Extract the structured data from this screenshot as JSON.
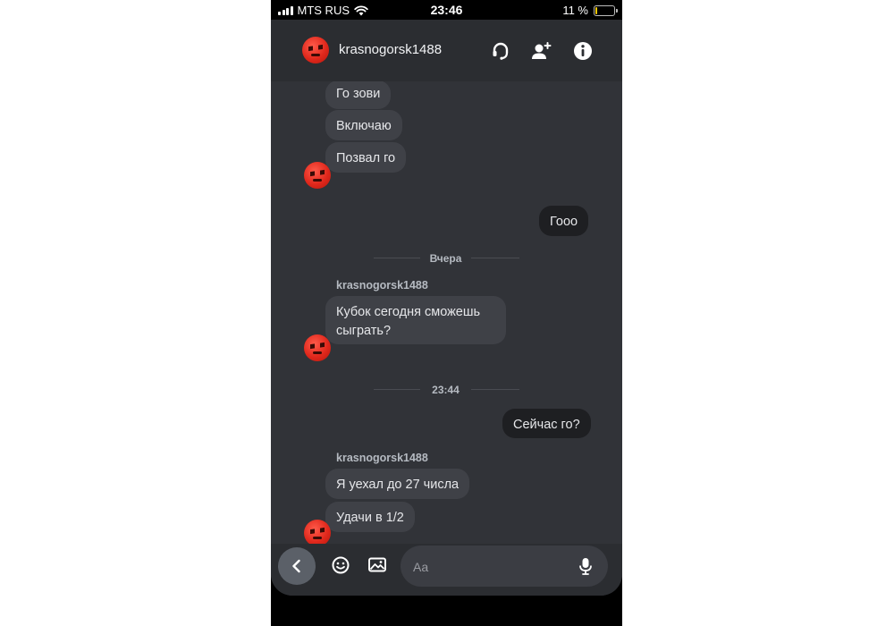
{
  "status_bar": {
    "carrier": "MTS RUS",
    "time": "23:46",
    "battery_percent": "11 %",
    "battery_level": 0.11
  },
  "header": {
    "title": "krasnogorsk1488",
    "icons": [
      "headset-icon",
      "add-friend-icon",
      "info-icon"
    ]
  },
  "messages": {
    "m1": "Го зови",
    "m2": "Включаю",
    "m3": "Позвал го",
    "m4": "Гооо",
    "divider1": "Вчера",
    "sender1": "krasnogorsk1488",
    "m5_line1": "Кубок сегодня сможешь",
    "m5_line2": "сыграть?",
    "divider2": "23:44",
    "m6": "Сейчас го?",
    "sender2": "krasnogorsk1488",
    "m7": "Я уехал до 27 числа",
    "m8": "Удачи в 1/2"
  },
  "composer": {
    "placeholder": "Aa",
    "icons": [
      "back-arrow-icon",
      "emoji-icon",
      "image-icon",
      "mic-icon"
    ]
  },
  "colors": {
    "background": "#313338",
    "header": "#2b2d31",
    "bubble_incoming": "#3f4147",
    "bubble_outgoing": "#1e1f22",
    "battery": "#ffcc00"
  }
}
